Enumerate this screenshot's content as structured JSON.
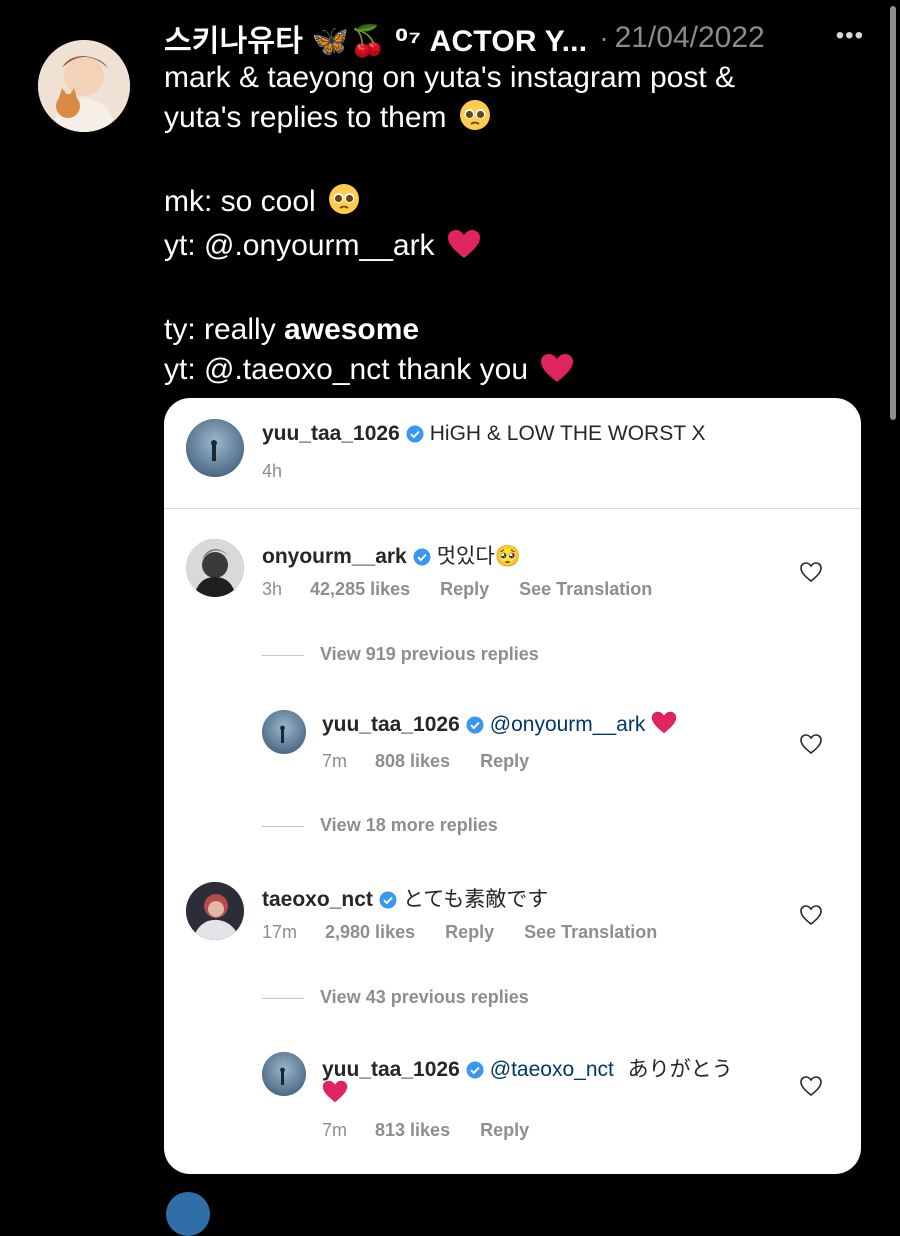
{
  "tweet": {
    "display_name": "스키나유타 🦋🍒 ⁰⁷ ACTOR Y...",
    "separator": "·",
    "date": "21/04/2022",
    "more_label": "•••",
    "line1": "mark & taeyong on yuta's instagram post &",
    "line2": "yuta's replies to them",
    "line3": "mk: so cool",
    "line4": "yt: @.onyourm__ark",
    "line5_prefix": "ty: really",
    "line5_bold": "awesome",
    "line6": "yt: @.taeoxo_nct thank you"
  },
  "card": {
    "post": {
      "username": "yuu_taa_1026",
      "caption": "HiGH & LOW THE WORST X",
      "time": "4h"
    },
    "comments": [
      {
        "username": "onyourm__ark",
        "text": "멋있다🥺",
        "time": "3h",
        "likes": "42,285 likes",
        "reply": "Reply",
        "translation": "See Translation",
        "view_replies": "View 919 previous replies",
        "reply_item": {
          "username": "yuu_taa_1026",
          "mention": "@onyourm__ark",
          "text": "",
          "time": "7m",
          "likes": "808 likes",
          "reply": "Reply"
        },
        "more_replies": "View 18 more replies"
      },
      {
        "username": "taeoxo_nct",
        "text": "とても素敵です",
        "time": "17m",
        "likes": "2,980 likes",
        "reply": "Reply",
        "translation": "See Translation",
        "view_replies": "View 43 previous replies",
        "reply_item": {
          "username": "yuu_taa_1026",
          "mention": "@taeoxo_nct",
          "text": "ありがとう",
          "time": "7m",
          "likes": "813 likes",
          "reply": "Reply"
        }
      }
    ]
  },
  "colors": {
    "background": "#000000",
    "card": "#ffffff",
    "verified_blue": "#3897f0",
    "mention_blue": "#00376b",
    "heart_red": "#e0245e",
    "muted": "#8e8e8e"
  },
  "icons": [
    "more-icon",
    "verified-icon",
    "heart-outline-icon",
    "red-heart-icon",
    "pleading-face-emoji"
  ]
}
